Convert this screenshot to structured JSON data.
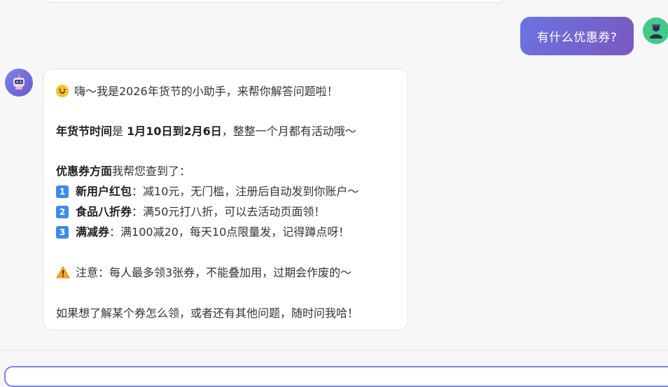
{
  "user_message": {
    "text": "有什么优惠券?"
  },
  "bot_message": {
    "greeting": "嗨～我是2026年货节的小助手，来帮你解答问题啦！",
    "time_label": "年货节时间",
    "time_is": "是 ",
    "time_range": "1月10日到2月6日",
    "time_suffix": "，整整一个月都有活动哦～",
    "coupon_label": "优惠券方面",
    "coupon_intro": "我帮您查到了：",
    "items": [
      {
        "num": "1",
        "title": "新用户红包",
        "desc": "：减10元，无门槛，注册后自动发到你账户～"
      },
      {
        "num": "2",
        "title": "食品八折券",
        "desc": "：满50元打八折，可以去活动页面领！"
      },
      {
        "num": "3",
        "title": "满减券",
        "desc": "：满100减20，每天10点限量发，记得蹲点呀！"
      }
    ],
    "note": "注意：每人最多领3张券，不能叠加用，过期会作废的～",
    "closing": "如果想了解某个券怎么领，或者还有其他问题，随时问我哈！"
  },
  "icons": {
    "user_avatar": "user-silhouette-icon",
    "bot_avatar": "robot-icon",
    "smile": "smiling-face-icon",
    "warning": "warning-icon"
  },
  "colors": {
    "user_bubble_start": "#6a74e2",
    "user_bubble_end": "#7b58bd",
    "user_avatar_bg": "#43c98a",
    "input_border": "#7a83e6"
  }
}
